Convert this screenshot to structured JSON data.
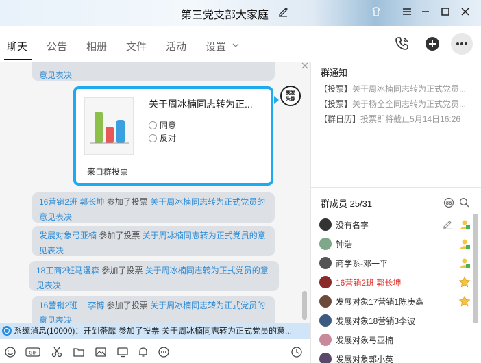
{
  "window": {
    "title": "第三党支部大家庭"
  },
  "nav": {
    "tabs": [
      {
        "label": "聊天",
        "active": true
      },
      {
        "label": "公告",
        "active": false
      },
      {
        "label": "相册",
        "active": false
      },
      {
        "label": "文件",
        "active": false
      },
      {
        "label": "活动",
        "active": false
      },
      {
        "label": "设置",
        "active": false
      }
    ]
  },
  "chat": {
    "top_bubble": {
      "link_tail": "意见表决"
    },
    "vote_card": {
      "title": "关于周冰楠同志转为正...",
      "options": [
        "同意",
        "反对"
      ],
      "source": "来自群投票",
      "avatar_text": "我爱\n头像"
    },
    "messages": [
      {
        "name": "16营销2班 郭长坤",
        "verb": "参加了投票",
        "link": "关于周冰楠同志转为正式党员的意见表决"
      },
      {
        "name": "发展对象弓亚楠",
        "verb": "参加了投票",
        "link": "关于周冰楠同志转为正式党员的意见表决"
      },
      {
        "name": "18工商2班马漫森",
        "verb": "参加了投票",
        "link": "关于周冰楠同志转为正式党员的意见表决"
      },
      {
        "name": "16营销2班　 李博",
        "verb": "参加了投票",
        "link": "关于周冰楠同志转为正式党员的意见表决"
      }
    ],
    "system_message": "系统消息(10000)：开到荼靡 参加了投票 关于周冰楠同志转为正式党员的意..."
  },
  "right_panel": {
    "notice_title": "群通知",
    "notices": [
      {
        "tag": "【投票】",
        "text": "关于周冰楠同志转为正式党员..."
      },
      {
        "tag": "【投票】",
        "text": "关于杨全全同志转为正式党员..."
      },
      {
        "tag": "【群日历】",
        "text": "投票即将截止5月14日16:26"
      }
    ],
    "members_title": "群成员 25/31",
    "members": [
      {
        "name": "没有名字",
        "role": "admin",
        "avatar_color": "#333333"
      },
      {
        "name": "钟浩",
        "role": "admin",
        "avatar_color": "#7fa78a"
      },
      {
        "name": "商学系-邓一平",
        "role": "admin",
        "avatar_color": "#555555"
      },
      {
        "name": "16营销2班 郭长坤",
        "role": "owner",
        "avatar_color": "#8b2a2a"
      },
      {
        "name": "发展对象17营销1陈庚鑫",
        "role": "star",
        "avatar_color": "#6b4a3a"
      },
      {
        "name": "发展对象18营销3李波",
        "role": "",
        "avatar_color": "#3c5a82"
      },
      {
        "name": "发展对象弓亚楠",
        "role": "",
        "avatar_color": "#c88a9a"
      },
      {
        "name": "发展对象郭小英",
        "role": "",
        "avatar_color": "#5a4a6a"
      }
    ]
  }
}
